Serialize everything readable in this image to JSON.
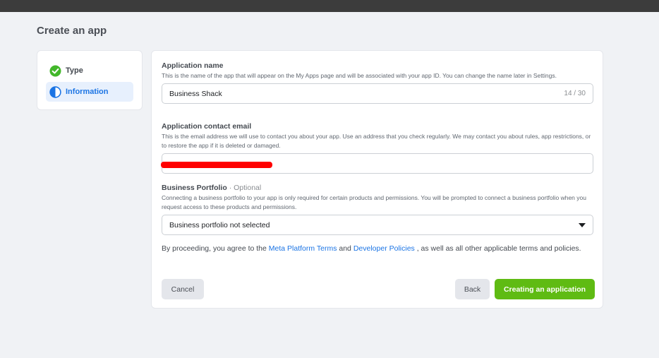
{
  "page": {
    "title": "Create an app"
  },
  "steps": [
    {
      "label": "Type",
      "status": "complete",
      "icon": "check-circle-icon"
    },
    {
      "label": "Information",
      "status": "active",
      "icon": "half-circle-icon"
    }
  ],
  "form": {
    "app_name": {
      "title": "Application name",
      "description": "This is the name of the app that will appear on the My Apps page and will be associated with your app ID. You can change the name later in Settings.",
      "value": "Business Shack",
      "counter": "14 / 30"
    },
    "contact_email": {
      "title": "Application contact email",
      "description": "This is the email address we will use to contact you about your app. Use an address that you check regularly. We may contact you about rules, app restrictions, or to restore the app if it is deleted or damaged.",
      "value": ""
    },
    "business_portfolio": {
      "title": "Business Portfolio",
      "separator": "·",
      "optional": "Optional",
      "description": "Connecting a business portfolio to your app is only required for certain products and permissions. You will be prompted to connect a business portfolio when you request access to these products and permissions.",
      "selected": "Business portfolio not selected"
    },
    "terms": {
      "prefix": "By proceeding, you agree to the",
      "link1": "Meta Platform Terms",
      "and": "and",
      "link2": "Developer Policies",
      "suffix": ", as well as all other applicable terms and policies."
    }
  },
  "buttons": {
    "cancel": "Cancel",
    "back": "Back",
    "create": "Creating an application"
  },
  "colors": {
    "accent_blue": "#1b74e4",
    "create_green": "#5fbb13",
    "check_green": "#42b72a",
    "redaction": "#ff0000"
  }
}
